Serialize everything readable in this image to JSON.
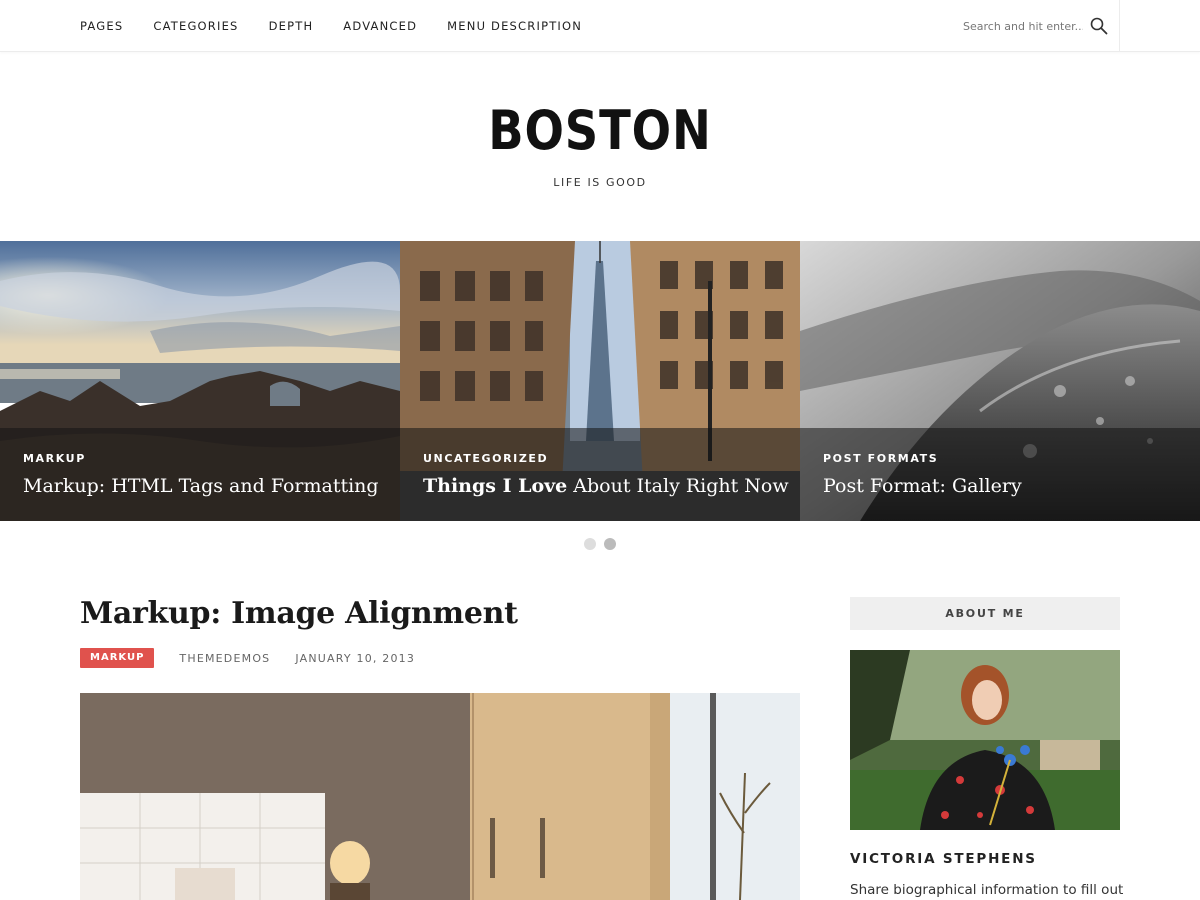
{
  "nav": {
    "items": [
      "Pages",
      "Categories",
      "Depth",
      "Advanced",
      "Menu Description"
    ]
  },
  "search": {
    "placeholder": "Search and hit enter...",
    "icon": "search-icon"
  },
  "site": {
    "title": "BOSTON",
    "tagline": "Life is Good"
  },
  "slider": {
    "slides": [
      {
        "category": "Markup",
        "title": "Markup: HTML Tags and Formatting",
        "title_bold": "",
        "title_rest": "Markup: HTML Tags and Formatting"
      },
      {
        "category": "Uncategorized",
        "title": "Things I Love About Italy Right Now",
        "title_bold": "Things I Love",
        "title_rest": " About Italy Right Now"
      },
      {
        "category": "Post Formats",
        "title": "Post Format: Gallery",
        "title_bold": "",
        "title_rest": "Post Format: Gallery"
      }
    ],
    "pages": 2,
    "active_page": 2
  },
  "post": {
    "title": "Markup: Image Alignment",
    "category": "Markup",
    "author": "themedemos",
    "date": "January 10, 2013"
  },
  "sidebar": {
    "widget_title": "About Me",
    "name": "Victoria Stephens",
    "bio": "Share biographical information to fill out"
  },
  "colors": {
    "accent": "#e0524d",
    "widget_bg": "#efefef"
  }
}
